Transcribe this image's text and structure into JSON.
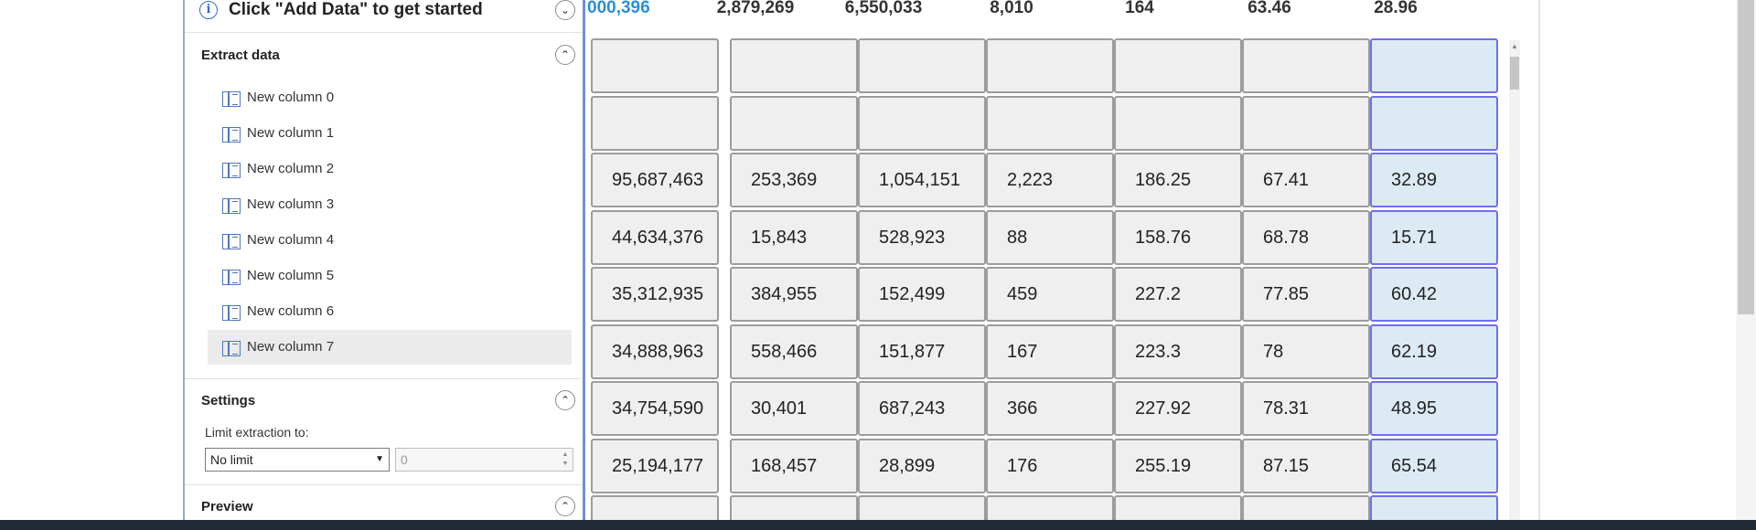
{
  "panel": {
    "info_text": "Click \"Add Data\" to get started",
    "extract_title": "Extract data",
    "columns": [
      {
        "label": "New column 0"
      },
      {
        "label": "New column 1"
      },
      {
        "label": "New column 2"
      },
      {
        "label": "New column 3"
      },
      {
        "label": "New column 4"
      },
      {
        "label": "New column 5"
      },
      {
        "label": "New column 6"
      },
      {
        "label": "New column 7"
      }
    ],
    "settings_title": "Settings",
    "limit_label": "Limit extraction to:",
    "limit_select_value": "No limit",
    "limit_input_value": "0",
    "preview_title": "Preview"
  },
  "table": {
    "totals": [
      "000,396",
      "2,879,269",
      "6,550,033",
      "8,010",
      "164",
      "63.46",
      "28.96"
    ],
    "rows": [
      [
        "",
        "",
        "",
        "",
        "",
        "",
        ""
      ],
      [
        "",
        "",
        "",
        "",
        "",
        "",
        ""
      ],
      [
        "95,687,463",
        "253,369",
        "1,054,151",
        "2,223",
        "186.25",
        "67.41",
        "32.89"
      ],
      [
        "44,634,376",
        "15,843",
        "528,923",
        "88",
        "158.76",
        "68.78",
        "15.71"
      ],
      [
        "35,312,935",
        "384,955",
        "152,499",
        "459",
        "227.2",
        "77.85",
        "60.42"
      ],
      [
        "34,888,963",
        "558,466",
        "151,877",
        "167",
        "223.3",
        "78",
        "62.19"
      ],
      [
        "34,754,590",
        "30,401",
        "687,243",
        "366",
        "227.92",
        "78.31",
        "48.95"
      ],
      [
        "25,194,177",
        "168,457",
        "28,899",
        "176",
        "255.19",
        "87.15",
        "65.54"
      ],
      [
        "",
        "",
        "",
        "",
        "",
        "",
        ""
      ]
    ]
  },
  "colors": {
    "accent": "#2a8fd6",
    "selected_border": "#6f6ff0",
    "selected_fill": "#dceaf3",
    "cell_fill": "#efefef"
  },
  "icons": [
    "info-icon",
    "chevron-up-icon",
    "chevron-down-icon",
    "column-icon",
    "dropdown-caret-icon"
  ]
}
